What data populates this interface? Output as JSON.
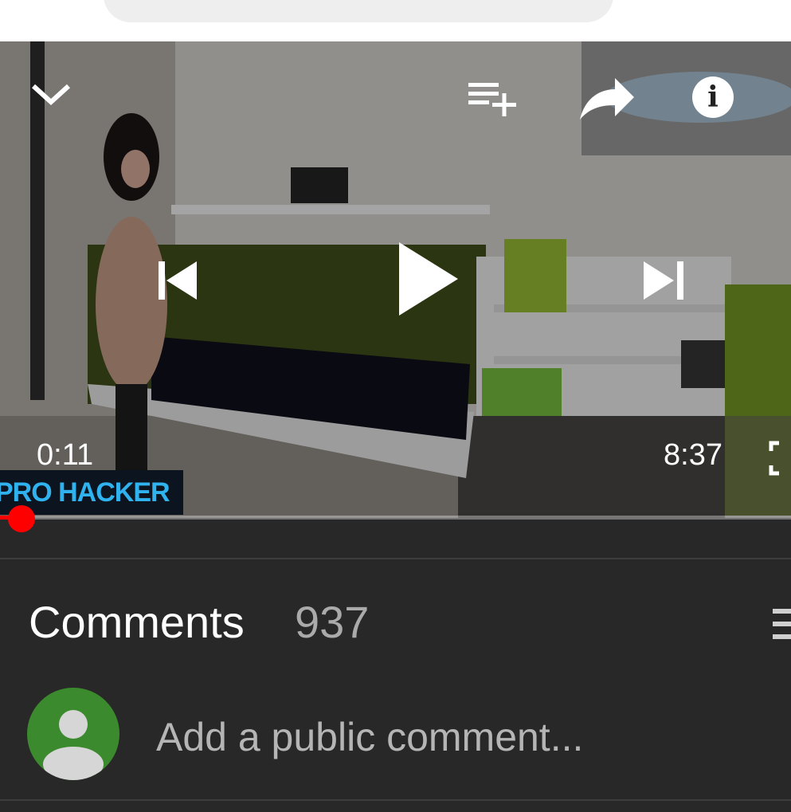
{
  "player": {
    "current_time": "0:11",
    "total_time": "8:37",
    "progress": 0.021,
    "channel_watermark": "PRO HACKER",
    "icons": {
      "collapse": "chevron-down-icon",
      "add_to_queue": "playlist-add-icon",
      "share": "share-icon",
      "info": "info-icon",
      "previous": "skip-previous-icon",
      "play": "play-icon",
      "next": "skip-next-icon",
      "fullscreen": "fullscreen-icon"
    },
    "info_glyph": "i"
  },
  "comments": {
    "title": "Comments",
    "count": "937",
    "input_placeholder": "Add a public comment...",
    "sort_icon": "sort-icon",
    "avatar_icon": "account-avatar-icon"
  },
  "colors": {
    "accent": "#ff0000",
    "background": "#282828",
    "avatar": "#3c8a2e"
  }
}
